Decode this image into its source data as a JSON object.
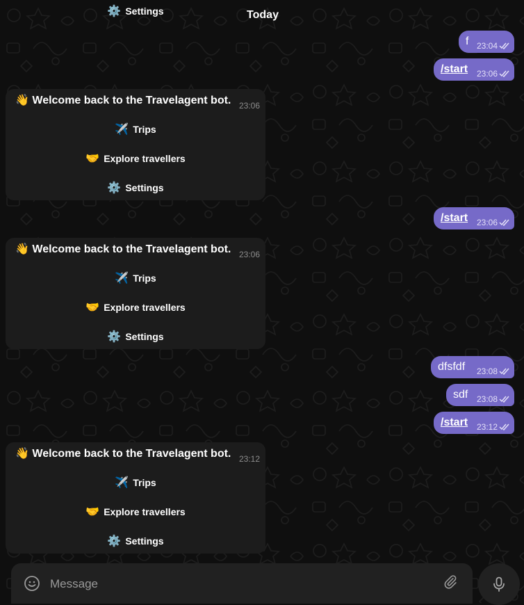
{
  "day_label": "Today",
  "top_settings_label": "Settings",
  "outgoing": [
    {
      "text": "f",
      "time": "23:04"
    },
    {
      "text": "/start",
      "time": "23:06"
    },
    {
      "text": "/start",
      "time": "23:06"
    },
    {
      "text": "dfsfdf",
      "time": "23:08"
    },
    {
      "text": "sdf",
      "time": "23:08"
    },
    {
      "text": "/start",
      "time": "23:12"
    }
  ],
  "bot_messages": [
    {
      "text": "Welcome back to the Travelagent bot.",
      "time": "23:06",
      "buttons": [
        {
          "emoji": "✈️",
          "label": "Trips"
        },
        {
          "emoji": "🤝",
          "label": "Explore travellers"
        },
        {
          "emoji": "⚙️",
          "label": "Settings"
        }
      ]
    },
    {
      "text": "Welcome back to the Travelagent bot.",
      "time": "23:06",
      "buttons": [
        {
          "emoji": "✈️",
          "label": "Trips"
        },
        {
          "emoji": "🤝",
          "label": "Explore travellers"
        },
        {
          "emoji": "⚙️",
          "label": "Settings"
        }
      ]
    },
    {
      "text": "Welcome back to the Travelagent bot.",
      "time": "23:12",
      "buttons": [
        {
          "emoji": "✈️",
          "label": "Trips"
        },
        {
          "emoji": "🤝",
          "label": "Explore travellers"
        },
        {
          "emoji": "⚙️",
          "label": "Settings"
        }
      ]
    }
  ],
  "wave_emoji": "👋",
  "settings_emoji": "⚙️",
  "composer": {
    "placeholder": "Message"
  },
  "icons": {
    "smile": "smile-icon",
    "attach": "paperclip-icon",
    "mic": "microphone-icon",
    "read": "double-check-icon"
  },
  "colors": {
    "background": "#0f0f0f",
    "outgoing_bubble": "#766ac8",
    "incoming_bubble": "#1c1c1c",
    "composer": "#212121"
  }
}
